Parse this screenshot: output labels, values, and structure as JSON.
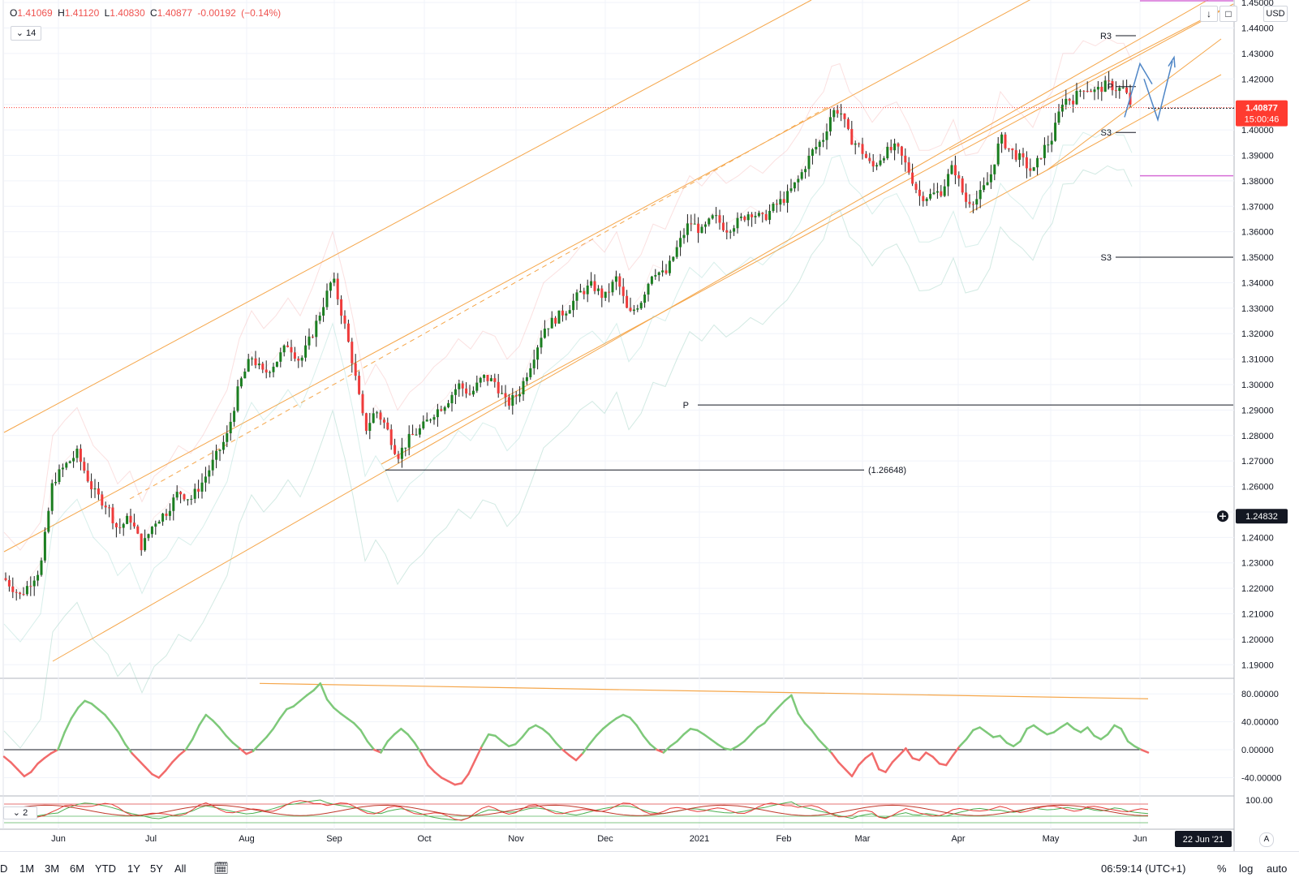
{
  "legend": {
    "open_label": "O",
    "open": "1.41069",
    "high_label": "H",
    "high": "1.41120",
    "low_label": "L",
    "low": "1.40830",
    "close_label": "C",
    "close": "1.40877",
    "change": "-0.00192",
    "change_pct": "(−0.14%)"
  },
  "interval_label": "14",
  "indicator2_label": "2",
  "currency_label": "USD",
  "icons": {
    "download": "download-icon",
    "fullscreen": "fullscreen-icon",
    "crosshair": "crosshair-icon",
    "chevron": "chevron-down-icon",
    "calendar": "calendar-range-icon"
  },
  "colors": {
    "up": "#1b7e20",
    "down": "#ef3b3b",
    "channel": "#f5a64a",
    "osc_up": "#7ec97a",
    "osc_down": "#f26b6b",
    "price_tag": "#ff3b30",
    "pivot_magenta": "#d66ed6",
    "arrow": "#4f86c6"
  },
  "price_tag": {
    "value": "1.40877",
    "countdown": "15:00:46"
  },
  "crosshair_tag": "1.24832",
  "date_tag": "22 Jun '21",
  "annotations": {
    "r3": "R3",
    "p": "P",
    "s3_upper": "S3",
    "s3_lower": "S3",
    "p_line": "P",
    "low_label": "(1.26648)"
  },
  "bottom_bar": {
    "ranges": [
      "D",
      "1M",
      "3M",
      "6M",
      "YTD",
      "1Y",
      "5Y",
      "All"
    ],
    "clock": "06:59:14 (UTC+1)",
    "percent": "%",
    "log": "log",
    "auto": "auto"
  },
  "scale_button": "A",
  "chart_data": [
    {
      "type": "candlestick",
      "title": "",
      "x_ticks": [
        "Jun",
        "Jul",
        "Aug",
        "Sep",
        "Oct",
        "Nov",
        "Dec",
        "2021",
        "Feb",
        "Mar",
        "Apr",
        "May",
        "Jun"
      ],
      "y_ticks": [
        "1.45000",
        "1.44000",
        "1.43000",
        "1.42000",
        "1.41000",
        "1.40000",
        "1.39000",
        "1.38000",
        "1.37000",
        "1.36000",
        "1.35000",
        "1.34000",
        "1.33000",
        "1.32000",
        "1.31000",
        "1.30000",
        "1.29000",
        "1.28000",
        "1.27000",
        "1.26000",
        "1.25000",
        "1.24000",
        "1.23000",
        "1.22000",
        "1.21000",
        "1.20000",
        "1.19000"
      ],
      "ylim": [
        1.185,
        1.451
      ],
      "close_path": [
        [
          0,
          1.224
        ],
        [
          20,
          1.217
        ],
        [
          45,
          1.228
        ],
        [
          60,
          1.262
        ],
        [
          75,
          1.268
        ],
        [
          90,
          1.273
        ],
        [
          110,
          1.258
        ],
        [
          128,
          1.252
        ],
        [
          140,
          1.243
        ],
        [
          155,
          1.248
        ],
        [
          170,
          1.236
        ],
        [
          185,
          1.246
        ],
        [
          200,
          1.25
        ],
        [
          215,
          1.258
        ],
        [
          230,
          1.255
        ],
        [
          245,
          1.262
        ],
        [
          260,
          1.271
        ],
        [
          275,
          1.28
        ],
        [
          290,
          1.3
        ],
        [
          305,
          1.311
        ],
        [
          320,
          1.304
        ],
        [
          335,
          1.309
        ],
        [
          350,
          1.316
        ],
        [
          365,
          1.309
        ],
        [
          380,
          1.32
        ],
        [
          395,
          1.333
        ],
        [
          405,
          1.342
        ],
        [
          420,
          1.323
        ],
        [
          430,
          1.308
        ],
        [
          445,
          1.282
        ],
        [
          458,
          1.29
        ],
        [
          470,
          1.284
        ],
        [
          485,
          1.272
        ],
        [
          500,
          1.279
        ],
        [
          515,
          1.283
        ],
        [
          530,
          1.289
        ],
        [
          545,
          1.293
        ],
        [
          560,
          1.3
        ],
        [
          575,
          1.296
        ],
        [
          590,
          1.303
        ],
        [
          605,
          1.301
        ],
        [
          620,
          1.292
        ],
        [
          635,
          1.297
        ],
        [
          650,
          1.309
        ],
        [
          665,
          1.322
        ],
        [
          680,
          1.326
        ],
        [
          695,
          1.33
        ],
        [
          710,
          1.336
        ],
        [
          725,
          1.339
        ],
        [
          740,
          1.334
        ],
        [
          755,
          1.342
        ],
        [
          770,
          1.327
        ],
        [
          785,
          1.333
        ],
        [
          800,
          1.345
        ],
        [
          815,
          1.343
        ],
        [
          830,
          1.354
        ],
        [
          845,
          1.364
        ],
        [
          860,
          1.36
        ],
        [
          875,
          1.366
        ],
        [
          890,
          1.361
        ],
        [
          905,
          1.364
        ],
        [
          920,
          1.368
        ],
        [
          935,
          1.365
        ],
        [
          950,
          1.37
        ],
        [
          965,
          1.374
        ],
        [
          980,
          1.381
        ],
        [
          995,
          1.391
        ],
        [
          1010,
          1.397
        ],
        [
          1020,
          1.407
        ],
        [
          1030,
          1.408
        ],
        [
          1042,
          1.397
        ],
        [
          1055,
          1.393
        ],
        [
          1070,
          1.385
        ],
        [
          1085,
          1.391
        ],
        [
          1100,
          1.393
        ],
        [
          1115,
          1.384
        ],
        [
          1128,
          1.374
        ],
        [
          1140,
          1.374
        ],
        [
          1155,
          1.376
        ],
        [
          1170,
          1.386
        ],
        [
          1185,
          1.372
        ],
        [
          1200,
          1.373
        ],
        [
          1215,
          1.381
        ],
        [
          1228,
          1.397
        ],
        [
          1240,
          1.392
        ],
        [
          1255,
          1.388
        ],
        [
          1268,
          1.383
        ],
        [
          1280,
          1.392
        ],
        [
          1292,
          1.397
        ],
        [
          1305,
          1.412
        ],
        [
          1318,
          1.412
        ],
        [
          1330,
          1.417
        ],
        [
          1345,
          1.415
        ],
        [
          1360,
          1.418
        ],
        [
          1372,
          1.416
        ],
        [
          1380,
          1.416
        ],
        [
          1390,
          1.409
        ]
      ],
      "pivot_levels": [
        {
          "label": "R3",
          "value": 1.437
        },
        {
          "label": "P",
          "value": 1.417
        },
        {
          "label": "S3",
          "value": 1.399
        },
        {
          "label": "S3",
          "value": 1.35
        },
        {
          "label": "P",
          "value": 1.292
        }
      ],
      "marked_low": 1.26648,
      "current_price": 1.40877,
      "crosshair_price": 1.24832
    },
    {
      "type": "line",
      "title": "",
      "y_ticks": [
        "80.00000",
        "40.00000",
        "0.00000",
        "-40.00000"
      ],
      "ylim": [
        -65,
        100
      ],
      "zero_line": 0,
      "values": [
        -10,
        -18,
        -28,
        -38,
        -32,
        -20,
        -12,
        -5,
        0,
        25,
        45,
        60,
        70,
        66,
        58,
        50,
        38,
        25,
        8,
        -5,
        -15,
        -25,
        -35,
        -40,
        -30,
        -18,
        -8,
        0,
        15,
        35,
        50,
        42,
        32,
        20,
        10,
        2,
        -6,
        -2,
        8,
        18,
        30,
        45,
        58,
        62,
        70,
        78,
        85,
        95,
        72,
        60,
        52,
        45,
        38,
        28,
        12,
        0,
        -4,
        12,
        22,
        30,
        22,
        10,
        -5,
        -22,
        -32,
        -40,
        -45,
        -50,
        -48,
        -35,
        -15,
        5,
        22,
        20,
        12,
        5,
        8,
        18,
        30,
        35,
        30,
        22,
        10,
        0,
        -8,
        -15,
        -5,
        8,
        20,
        30,
        38,
        45,
        50,
        46,
        35,
        20,
        8,
        0,
        -4,
        5,
        12,
        22,
        30,
        28,
        22,
        15,
        8,
        2,
        0,
        5,
        12,
        22,
        32,
        38,
        50,
        60,
        70,
        78,
        52,
        38,
        28,
        15,
        5,
        -5,
        -18,
        -28,
        -38,
        -22,
        -12,
        -5,
        -28,
        -32,
        -18,
        -8,
        2,
        -12,
        -15,
        -4,
        -10,
        -20,
        -22,
        -8,
        5,
        15,
        28,
        32,
        25,
        18,
        20,
        10,
        5,
        12,
        30,
        35,
        28,
        22,
        25,
        32,
        38,
        30,
        25,
        32,
        20,
        15,
        22,
        35,
        30,
        12,
        5,
        0,
        -4
      ]
    }
  ]
}
